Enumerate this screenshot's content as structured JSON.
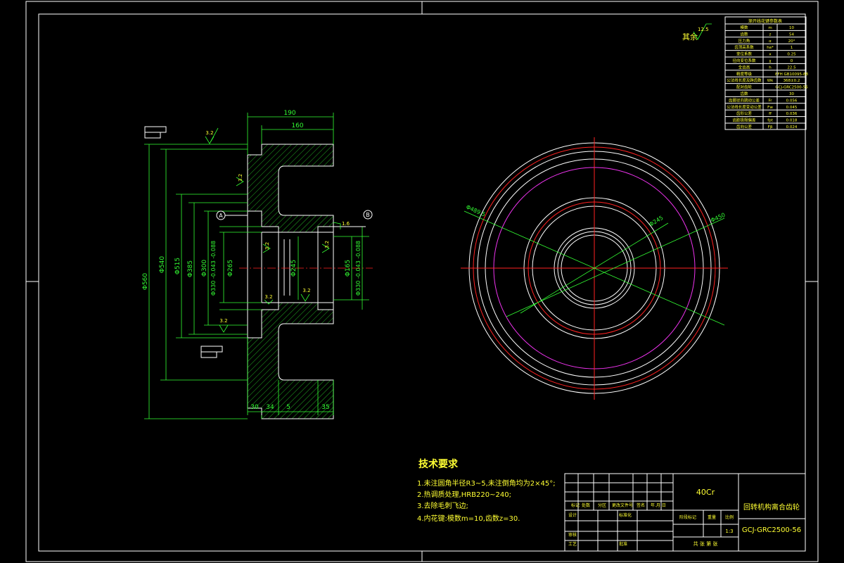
{
  "drawing": {
    "roughness_note": "其余",
    "roughness_value": "12.5",
    "section_marks": [
      "A",
      "B"
    ],
    "dim_top": [
      "190",
      "160"
    ],
    "dim_bottom": [
      "30",
      "34",
      "5",
      "35"
    ],
    "dim_left_dia": [
      "Φ560",
      "Φ540",
      "Φ515",
      "Φ385",
      "Φ300",
      "Φ330 -0.043 -0.088",
      "Φ265"
    ],
    "dim_inner": [
      "Φ245",
      "Φ165",
      "Φ330 -0.043 -0.088"
    ],
    "roughness_marks": [
      "3.2",
      "3.2",
      "3.2",
      "3.2",
      "3.2",
      "3.2",
      "1.6",
      "3.2"
    ],
    "circle_labels": [
      "Φ489.5",
      "Φ245",
      "Φ450"
    ]
  },
  "tech_req": {
    "title": "技术要求",
    "items": [
      "1.未注圆角半径R3~5,未注倒角均为2×45°;",
      "2.热调质处理,HRB220~240;",
      "3.去除毛刺飞边;",
      "4.内花键:模数m=10,齿数z=30."
    ]
  },
  "param_table": {
    "title": "渐开线花键参数表",
    "rows": [
      [
        "模数",
        "m",
        "10"
      ],
      [
        "齿数",
        "z",
        "54"
      ],
      [
        "压力角",
        "α",
        "20°"
      ],
      [
        "齿顶高系数",
        "ha*",
        "1"
      ],
      [
        "变位系数",
        "x",
        "0.25"
      ],
      [
        "径向变位系数",
        "χ",
        "0"
      ],
      [
        "全齿高",
        "h",
        "22.5"
      ],
      [
        "精度等级",
        "",
        "8FH GB10095-88"
      ],
      [
        "公法线长度及跨齿数",
        "Wk",
        "368±0.2"
      ],
      [
        "配对齿轮",
        "",
        "GCJ-GRC2500-56"
      ],
      [
        "齿数",
        "",
        "30"
      ],
      [
        "齿圈径向跳动公差",
        "Fr",
        "0.056"
      ],
      [
        "公法线长度变动公差",
        "Fw",
        "0.045"
      ],
      [
        "齿形公差",
        "ff",
        "0.036"
      ],
      [
        "齿距极限偏差",
        "fpt",
        "0.018"
      ],
      [
        "齿向公差",
        "Fβ",
        "0.024"
      ]
    ]
  },
  "title_block": {
    "material": "40Cr",
    "part_name": "回转机构离合齿轮",
    "drawing_no": "GCJ-GRC2500-56",
    "scale": "1:3",
    "mark_labels": [
      "标记",
      "处数",
      "分区",
      "更改文件号",
      "签名",
      "年.月.日"
    ],
    "designer_label": "设计",
    "standard_label": "标准化",
    "review_label": "审核",
    "process_label": "工艺",
    "approve_label": "批准",
    "stage_label": "阶段标记",
    "weight_label": "重量",
    "ratio_label": "比例",
    "sheets_label": "共  张  第  张"
  }
}
